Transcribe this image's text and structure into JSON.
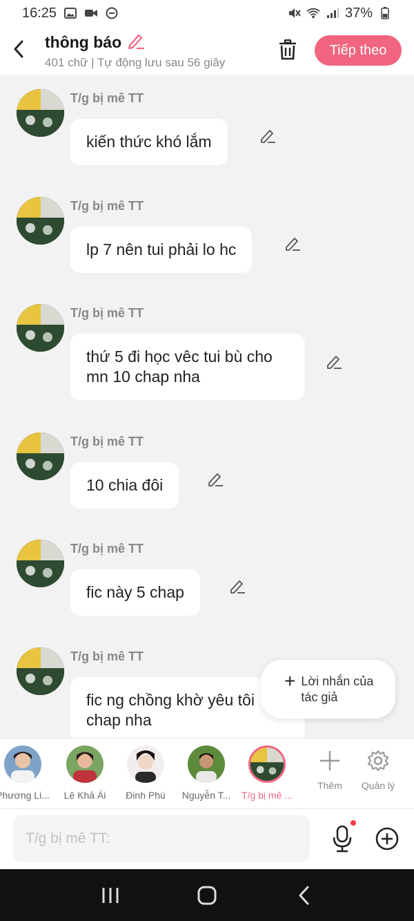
{
  "status_bar": {
    "time": "16:25",
    "battery": "37%",
    "icons": [
      "gallery-icon",
      "video-icon",
      "do-not-disturb-icon",
      "mute-icon",
      "wifi-icon",
      "signal-icon",
      "battery-icon"
    ]
  },
  "header": {
    "title": "thông báo",
    "subtitle": "401 chữ | Tự động lưu sau 56 giây",
    "next_label": "Tiếp theo",
    "accent_color": "#f26580"
  },
  "messages": [
    {
      "sender": "T/g bị mê TT",
      "text": "kiến thức khó lắm"
    },
    {
      "sender": "T/g bị mê TT",
      "text": "lp 7 nên tui phải lo hc"
    },
    {
      "sender": "T/g bị mê TT",
      "text": "thứ 5 đi học vêc tui bù cho mn 10 chap nha"
    },
    {
      "sender": "T/g bị mê TT",
      "text": "10 chia đôi"
    },
    {
      "sender": "T/g bị mê TT",
      "text": "fic này 5 chap"
    },
    {
      "sender": "T/g bị mê TT",
      "text": "fic ng chồng khờ yêu tôi chap nha"
    }
  ],
  "author_note": {
    "label": "Lời nhắn của tác giả"
  },
  "characters": [
    {
      "name": "Phương Li..."
    },
    {
      "name": "Lê Khả Ái"
    },
    {
      "name": "Đinh Phú"
    },
    {
      "name": "Nguyễn T..."
    },
    {
      "name": "T/g bị mê ..."
    }
  ],
  "tools": {
    "add_label": "Thêm",
    "manage_label": "Quản lý"
  },
  "input": {
    "placeholder": "T/g bị mê TT:"
  }
}
